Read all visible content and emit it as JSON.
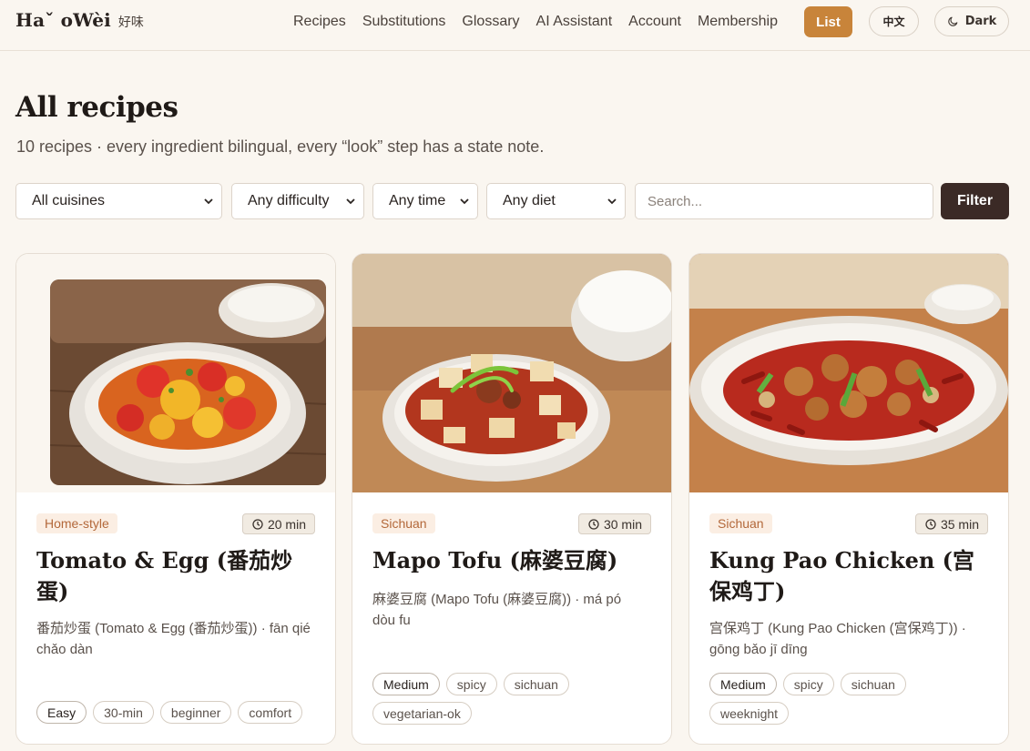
{
  "header": {
    "brand_name": "Haˇ oWèi",
    "brand_cn": "好味",
    "nav": [
      "Recipes",
      "Substitutions",
      "Glossary",
      "AI Assistant",
      "Account",
      "Membership"
    ],
    "list_label": "List",
    "lang_label": "中文",
    "dark_label": "Dark"
  },
  "main": {
    "title": "All recipes",
    "subtitle": "10 recipes · every ingredient bilingual, every “look” step has a state note."
  },
  "filters": {
    "cuisine": "All cuisines",
    "difficulty": "Any difficulty",
    "time": "Any time",
    "diet": "Any diet",
    "search_placeholder": "Search...",
    "filter_label": "Filter"
  },
  "recipes": [
    {
      "cuisine": "Home-style",
      "time": "20 min",
      "title": "Tomato & Egg (番茄炒蛋)",
      "subtitle": "番茄炒蛋 (Tomato & Egg (番茄炒蛋)) · fān qié chǎo dàn",
      "tags": [
        "Easy",
        "30-min",
        "beginner",
        "comfort"
      ]
    },
    {
      "cuisine": "Sichuan",
      "time": "30 min",
      "title": "Mapo Tofu (麻婆豆腐)",
      "subtitle": "麻婆豆腐 (Mapo Tofu (麻婆豆腐)) · má pó dòu fu",
      "tags": [
        "Medium",
        "spicy",
        "sichuan",
        "vegetarian-ok"
      ]
    },
    {
      "cuisine": "Sichuan",
      "time": "35 min",
      "title": "Kung Pao Chicken (宫保鸡丁)",
      "subtitle": "宫保鸡丁 (Kung Pao Chicken (宫保鸡丁)) · gōng bǎo jī dīng",
      "tags": [
        "Medium",
        "spicy",
        "sichuan",
        "weeknight"
      ]
    }
  ],
  "colors": {
    "accent": "#c8843a",
    "filter_button": "#3b2a26",
    "background": "#faf6f0"
  }
}
